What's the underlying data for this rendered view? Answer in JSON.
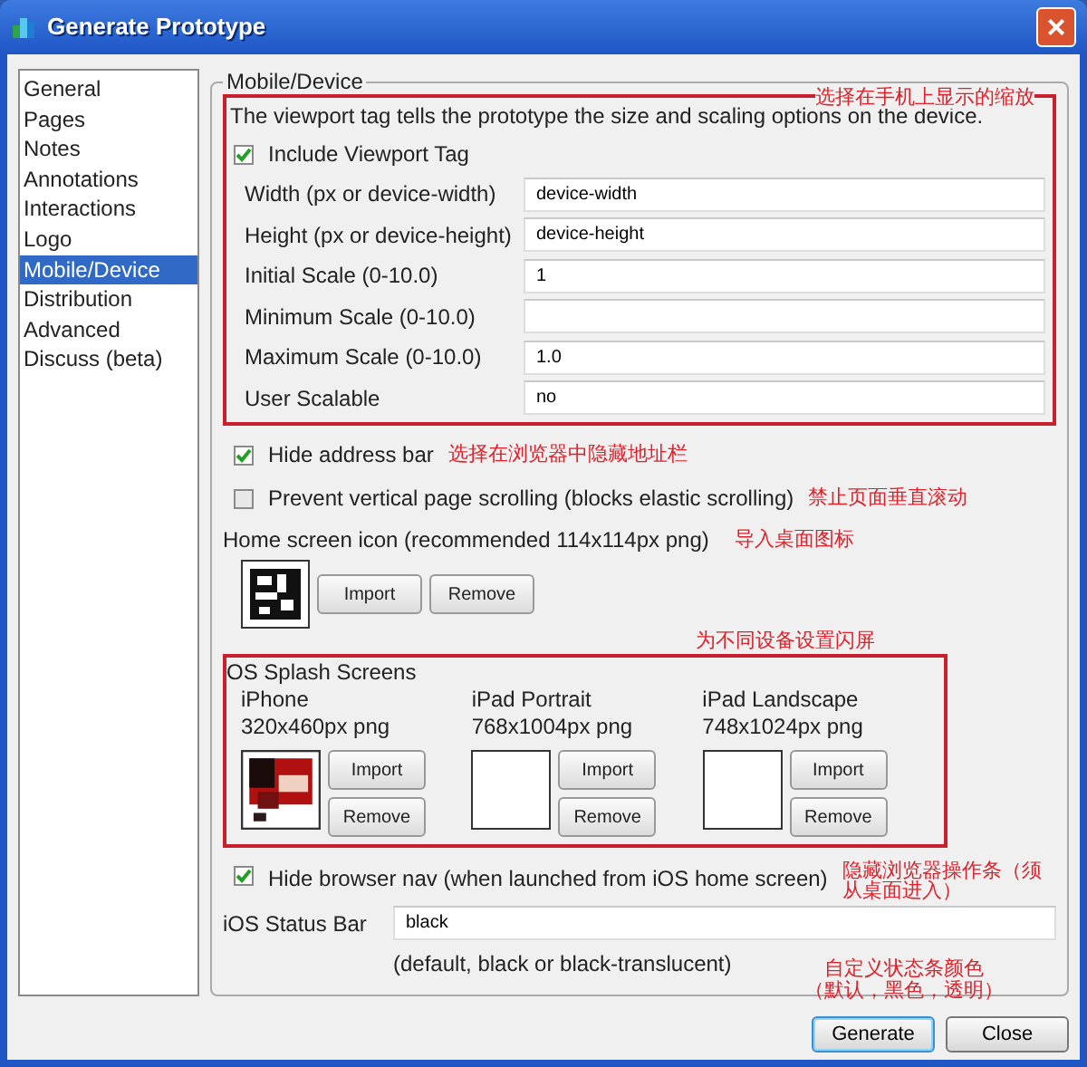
{
  "window": {
    "title": "Generate Prototype",
    "close": "×"
  },
  "sidebar": {
    "items": [
      {
        "label": "General",
        "selected": false
      },
      {
        "label": "Pages",
        "selected": false
      },
      {
        "label": "Notes",
        "selected": false
      },
      {
        "label": "Annotations",
        "selected": false
      },
      {
        "label": "Interactions",
        "selected": false
      },
      {
        "label": "Logo",
        "selected": false
      },
      {
        "label": "Mobile/Device",
        "selected": true
      },
      {
        "label": "Distribution",
        "selected": false
      },
      {
        "label": "Advanced",
        "selected": false
      },
      {
        "label": "Discuss (beta)",
        "selected": false
      }
    ]
  },
  "group": {
    "title": "Mobile/Device"
  },
  "viewport": {
    "annotation": "选择在手机上显示的缩放",
    "description": "The viewport tag tells the prototype the size and scaling options on the device.",
    "include": {
      "label": "Include Viewport Tag",
      "checked": true
    },
    "fields": [
      {
        "label": "Width (px or device-width)",
        "value": "device-width"
      },
      {
        "label": "Height (px or device-height)",
        "value": "device-height"
      },
      {
        "label": "Initial Scale (0-10.0)",
        "value": "1"
      },
      {
        "label": "Minimum Scale (0-10.0)"
      },
      {
        "label": "Maximum Scale (0-10.0)",
        "value": "1.0"
      },
      {
        "label": "User Scalable",
        "value": "no"
      }
    ]
  },
  "options": [
    {
      "label": "Hide address bar",
      "checked": true,
      "annotation": "选择在浏览器中隐藏地址栏"
    },
    {
      "label": "Prevent vertical page scrolling (blocks elastic scrolling)",
      "checked": false,
      "annotation": "禁止页面垂直滚动"
    }
  ],
  "home_icon": {
    "label": "Home screen icon (recommended 114x114px png)",
    "annotation": "导入桌面图标",
    "has_image": true,
    "buttons": [
      "Import",
      "Remove"
    ]
  },
  "splash": {
    "annotation": "为不同设备设置闪屏",
    "title": "OS Splash Screens",
    "devices": [
      {
        "name": "iPhone",
        "size": "320x460px png",
        "has_image": true,
        "buttons": [
          "Import",
          "Remove"
        ]
      },
      {
        "name": "iPad Portrait",
        "size": "768x1004px png",
        "has_image": false,
        "buttons": [
          "Import",
          "Remove"
        ]
      },
      {
        "name": "iPad Landscape",
        "size": "748x1024px png",
        "has_image": false,
        "buttons": [
          "Import",
          "Remove"
        ]
      }
    ]
  },
  "hide_nav": {
    "label": "Hide browser nav (when launched from iOS home screen)",
    "checked": true,
    "annotation": "隐藏浏览器操作条（须从桌面进入）"
  },
  "status_bar": {
    "label": "iOS Status Bar",
    "value": "black",
    "hint": "(default, black or black-translucent)",
    "annotation_lines": [
      "自定义状态条颜色",
      "（默认，黑色，透明）"
    ]
  },
  "buttons": [
    {
      "label": "Generate",
      "default": true
    },
    {
      "label": "Close",
      "default": false
    }
  ]
}
